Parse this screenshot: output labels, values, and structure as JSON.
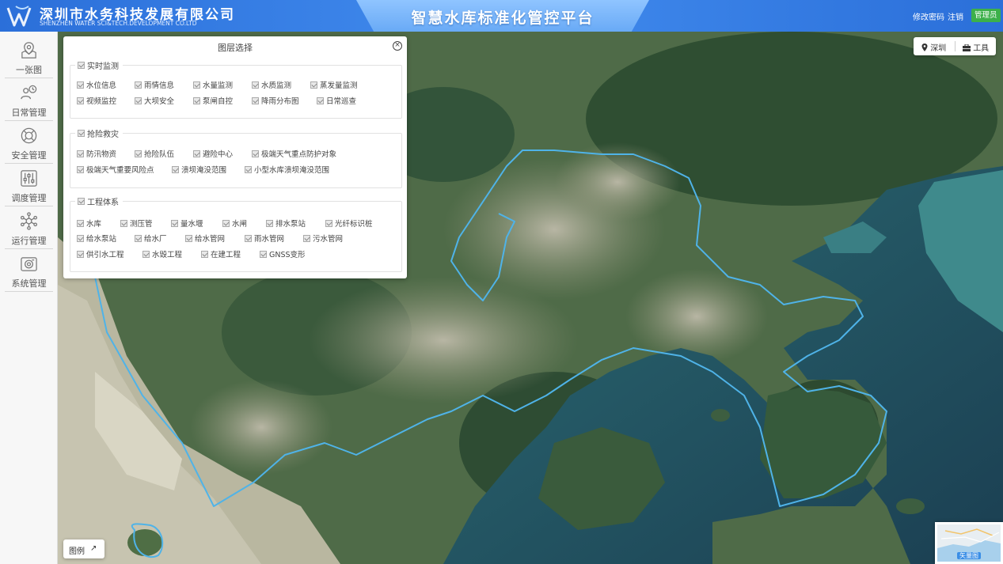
{
  "header": {
    "company_cn": "深圳市水务科技发展有限公司",
    "company_en": "SHENZHEN WATER SCI&TECH.DEVELOPMENT CO.LTD",
    "title": "智慧水库标准化管控平台",
    "change_password": "修改密码",
    "logout": "注销",
    "user_role": "管理员"
  },
  "sidebar": {
    "items": [
      {
        "label": "一张图",
        "icon": "map-pin-icon"
      },
      {
        "label": "日常管理",
        "icon": "daily-management-icon"
      },
      {
        "label": "安全管理",
        "icon": "lifebuoy-icon"
      },
      {
        "label": "调度管理",
        "icon": "sliders-icon"
      },
      {
        "label": "运行管理",
        "icon": "network-icon"
      },
      {
        "label": "系统管理",
        "icon": "camera-icon"
      }
    ]
  },
  "layer_panel": {
    "title": "图层选择",
    "groups": [
      {
        "name": "实时监测",
        "rows": [
          [
            "水位信息",
            "雨情信息",
            "水量监测",
            "水质监测",
            "蒸发量监测"
          ],
          [
            "视频监控",
            "大坝安全",
            "泵闸自控",
            "降雨分布图",
            "日常巡查"
          ]
        ]
      },
      {
        "name": "抢险救灾",
        "rows": [
          [
            "防汛物资",
            "抢险队伍",
            "避险中心",
            "极端天气重点防护对象"
          ],
          [
            "极端天气重要风险点",
            "溃坝淹没范围",
            "小型水库溃坝淹没范围"
          ]
        ]
      },
      {
        "name": "工程体系",
        "rows": [
          [
            "水库",
            "测压管",
            "量水堰",
            "水闸",
            "排水泵站",
            "光纤标识桩"
          ],
          [
            "给水泵站",
            "给水厂",
            "给水管网",
            "雨水管网",
            "污水管网"
          ],
          [
            "供引水工程",
            "水毁工程",
            "在建工程",
            "GNSS变形"
          ]
        ]
      }
    ]
  },
  "map_tools": {
    "location": "深圳",
    "tools": "工具"
  },
  "legend": {
    "label": "图例"
  },
  "mini_map": {
    "label": "矢量图"
  },
  "colors": {
    "header": "#3d86ea",
    "title_tab": "#7db8fb",
    "admin_badge": "#3cb04a",
    "boundary": "#4fb3e8"
  }
}
